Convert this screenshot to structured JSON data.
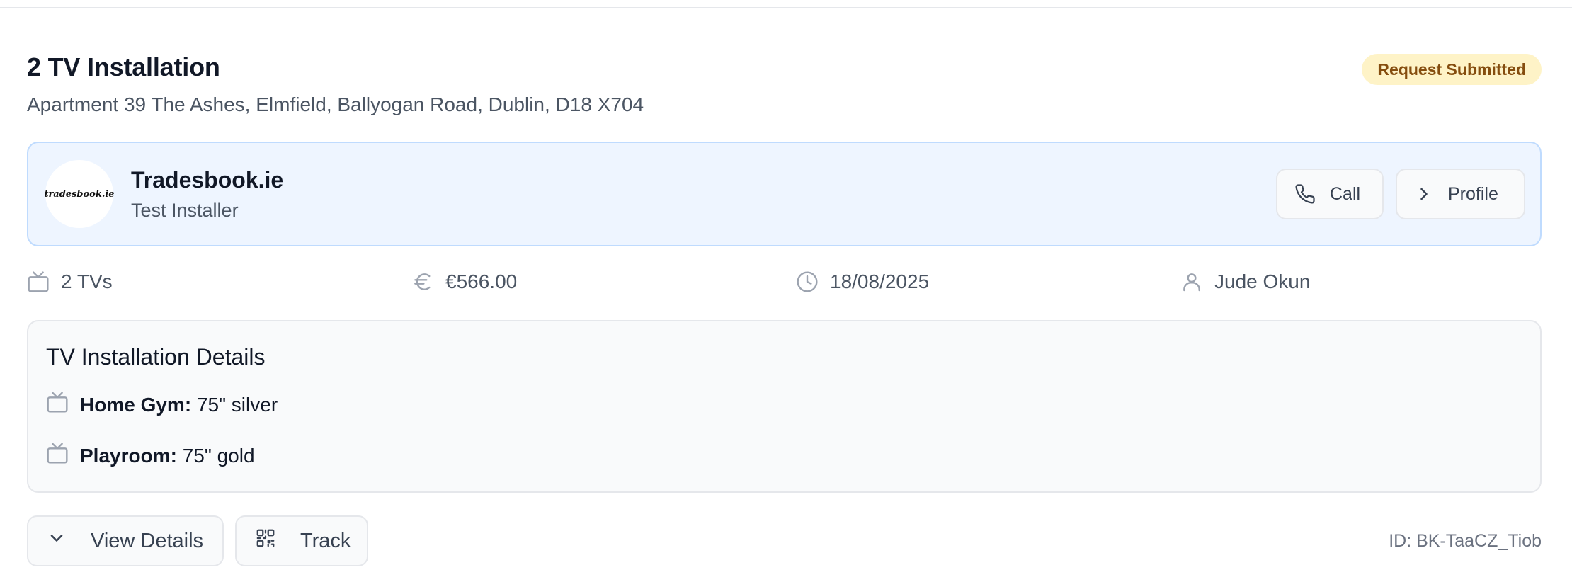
{
  "booking": {
    "title": "2 TV Installation",
    "address": "Apartment 39 The Ashes, Elmfield, Ballyogan Road, Dublin, D18 X704",
    "status": "Request Submitted",
    "id_label": "ID: BK-TaaCZ_Tiob"
  },
  "provider": {
    "logo_text": "tradesbook.ie",
    "name": "Tradesbook.ie",
    "role": "Test Installer",
    "call_label": "Call",
    "profile_label": "Profile"
  },
  "meta": {
    "tv_count": "2 TVs",
    "price": "€566.00",
    "date": "18/08/2025",
    "customer": "Jude Okun"
  },
  "details": {
    "title": "TV Installation Details",
    "items": [
      {
        "room": "Home Gym:",
        "spec": "75\" silver"
      },
      {
        "room": "Playroom:",
        "spec": "75\" gold"
      }
    ]
  },
  "actions": {
    "view_details_label": "View Details",
    "track_label": "Track"
  },
  "colors": {
    "badge_bg": "#fef3c7",
    "badge_text": "#854d0e",
    "provider_bg": "#eef5ff",
    "provider_border": "#bfdbfe"
  },
  "icons": [
    "phone-icon",
    "chevron-right-icon",
    "tv-icon",
    "euro-icon",
    "clock-icon",
    "user-icon",
    "chevron-down-icon",
    "qr-code-icon"
  ]
}
